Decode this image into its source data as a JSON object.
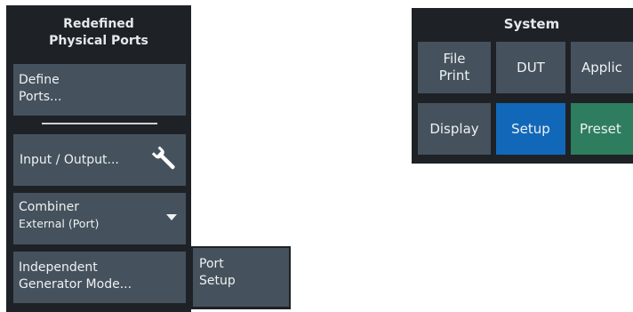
{
  "left_panel": {
    "title_line1": "Redefined",
    "title_line2": "Physical Ports",
    "define_ports": {
      "line1": "Define",
      "line2": "Ports..."
    },
    "input_output": {
      "label": "Input / Output..."
    },
    "combiner": {
      "line1": "Combiner",
      "line2": "External (Port)"
    },
    "independent_generator": {
      "line1": "Independent",
      "line2": "Generator Mode..."
    }
  },
  "port_setup": {
    "line1": "Port",
    "line2": "Setup"
  },
  "system_panel": {
    "title": "System",
    "buttons": [
      {
        "line1": "File",
        "line2": "Print"
      },
      {
        "label": "DUT"
      },
      {
        "label": "Applic"
      },
      {
        "label": "Display"
      },
      {
        "label": "Setup"
      },
      {
        "label": "Preset"
      }
    ]
  },
  "colors": {
    "panel_bg": "#1e2226",
    "button_bg": "#45525d",
    "setup_active": "#1268b8",
    "preset_green": "#2e7d5e",
    "text": "#eef1f3"
  },
  "icons": {
    "input_output": "wrench-icon",
    "combiner": "dropdown-caret-icon"
  }
}
